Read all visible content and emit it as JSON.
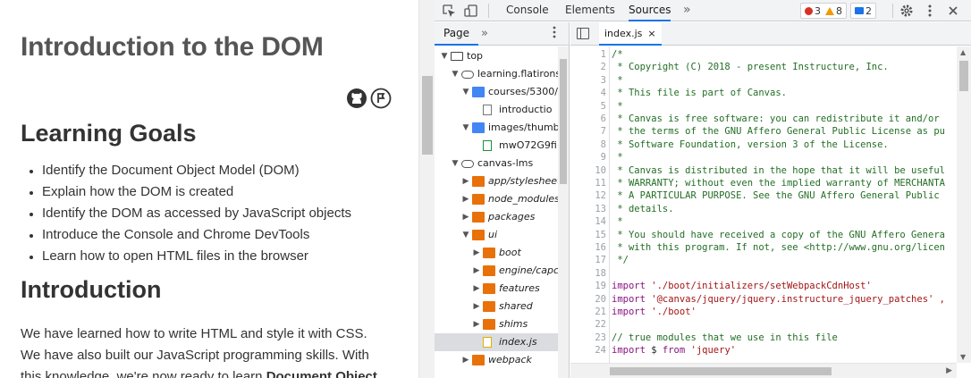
{
  "page": {
    "title": "Introduction to the DOM",
    "h2_goals": "Learning Goals",
    "goals": [
      "Identify the Document Object Model (DOM)",
      "Explain how the DOM is created",
      "Identify the DOM as accessed by JavaScript objects",
      "Introduce the Console and Chrome DevTools",
      "Learn how to open HTML files in the browser"
    ],
    "h2_intro": "Introduction",
    "para_1": "We have learned how to write HTML and style it with CSS.",
    "para_2": "We have also built our JavaScript programming skills. With",
    "para_3_a": "this knowledge, we're now ready to learn ",
    "para_3_b": "Document Object"
  },
  "devtools": {
    "tabs": [
      "Console",
      "Elements",
      "Sources"
    ],
    "active_tab": "Sources",
    "more_tabs": "»",
    "errors": "3",
    "warnings": "8",
    "messages": "2",
    "navigator": {
      "tab": "Page",
      "more": "»",
      "tree": [
        {
          "label": "top",
          "icon": "frame",
          "arrow": "down",
          "indent": 0
        },
        {
          "label": "learning.flatirons",
          "icon": "cloud",
          "arrow": "down",
          "indent": 1
        },
        {
          "label": "courses/5300/",
          "icon": "folder-blue",
          "arrow": "down",
          "indent": 2
        },
        {
          "label": "introductio",
          "icon": "file-gray",
          "arrow": "",
          "indent": 3
        },
        {
          "label": "images/thumb",
          "icon": "folder-blue",
          "arrow": "down",
          "indent": 2
        },
        {
          "label": "mwO72G9fi",
          "icon": "file-green",
          "arrow": "",
          "indent": 3
        },
        {
          "label": "canvas-lms",
          "icon": "cloud",
          "arrow": "down",
          "indent": 1
        },
        {
          "label": "app/stylesheet",
          "icon": "folder-orange",
          "arrow": "right",
          "indent": 2,
          "italic": true
        },
        {
          "label": "node_modules",
          "icon": "folder-orange",
          "arrow": "right",
          "indent": 2,
          "italic": true
        },
        {
          "label": "packages",
          "icon": "folder-orange",
          "arrow": "right",
          "indent": 2,
          "italic": true
        },
        {
          "label": "ui",
          "icon": "folder-orange",
          "arrow": "down",
          "indent": 2,
          "italic": true
        },
        {
          "label": "boot",
          "icon": "folder-orange",
          "arrow": "right",
          "indent": 3,
          "italic": true
        },
        {
          "label": "engine/capc",
          "icon": "folder-orange",
          "arrow": "right",
          "indent": 3,
          "italic": true
        },
        {
          "label": "features",
          "icon": "folder-orange",
          "arrow": "right",
          "indent": 3,
          "italic": true
        },
        {
          "label": "shared",
          "icon": "folder-orange",
          "arrow": "right",
          "indent": 3,
          "italic": true
        },
        {
          "label": "shims",
          "icon": "folder-orange",
          "arrow": "right",
          "indent": 3,
          "italic": true
        },
        {
          "label": "index.js",
          "icon": "file-js",
          "arrow": "",
          "indent": 3,
          "italic": true,
          "selected": true
        },
        {
          "label": "webpack",
          "icon": "folder-orange",
          "arrow": "right",
          "indent": 2,
          "italic": true
        }
      ]
    },
    "editor": {
      "file_tab": "index.js",
      "close": "×",
      "lines": [
        {
          "n": "1",
          "t": "/*",
          "c": "com"
        },
        {
          "n": "2",
          "t": " * Copyright (C) 2018 - present Instructure, Inc.",
          "c": "com"
        },
        {
          "n": "3",
          "t": " *",
          "c": "com"
        },
        {
          "n": "4",
          "t": " * This file is part of Canvas.",
          "c": "com"
        },
        {
          "n": "5",
          "t": " *",
          "c": "com"
        },
        {
          "n": "6",
          "t": " * Canvas is free software: you can redistribute it and/or",
          "c": "com"
        },
        {
          "n": "7",
          "t": " * the terms of the GNU Affero General Public License as pu",
          "c": "com"
        },
        {
          "n": "8",
          "t": " * Software Foundation, version 3 of the License.",
          "c": "com"
        },
        {
          "n": "9",
          "t": " *",
          "c": "com"
        },
        {
          "n": "10",
          "t": " * Canvas is distributed in the hope that it will be useful",
          "c": "com"
        },
        {
          "n": "11",
          "t": " * WARRANTY; without even the implied warranty of MERCHANTA",
          "c": "com"
        },
        {
          "n": "12",
          "t": " * A PARTICULAR PURPOSE. See the GNU Affero General Public ",
          "c": "com"
        },
        {
          "n": "13",
          "t": " * details.",
          "c": "com"
        },
        {
          "n": "14",
          "t": " *",
          "c": "com"
        },
        {
          "n": "15",
          "t": " * You should have received a copy of the GNU Affero Genera",
          "c": "com"
        },
        {
          "n": "16",
          "t": " * with this program. If not, see <http://www.gnu.org/licen",
          "c": "com"
        },
        {
          "n": "17",
          "t": " */",
          "c": "com"
        },
        {
          "n": "18",
          "t": "",
          "c": ""
        },
        {
          "n": "19",
          "kw": "import",
          "str": " './boot/initializers/setWebpackCdnHost'"
        },
        {
          "n": "20",
          "kw": "import",
          "str": " '@canvas/jquery/jquery.instructure_jquery_patches' ,"
        },
        {
          "n": "21",
          "kw": "import",
          "str": " './boot'"
        },
        {
          "n": "22",
          "t": "",
          "c": ""
        },
        {
          "n": "23",
          "t": "// true modules that we use in this file",
          "c": "com"
        },
        {
          "n": "24",
          "kw": "import",
          "plain": " $ ",
          "kw2": "from",
          "str": " 'jquery'"
        }
      ]
    }
  }
}
